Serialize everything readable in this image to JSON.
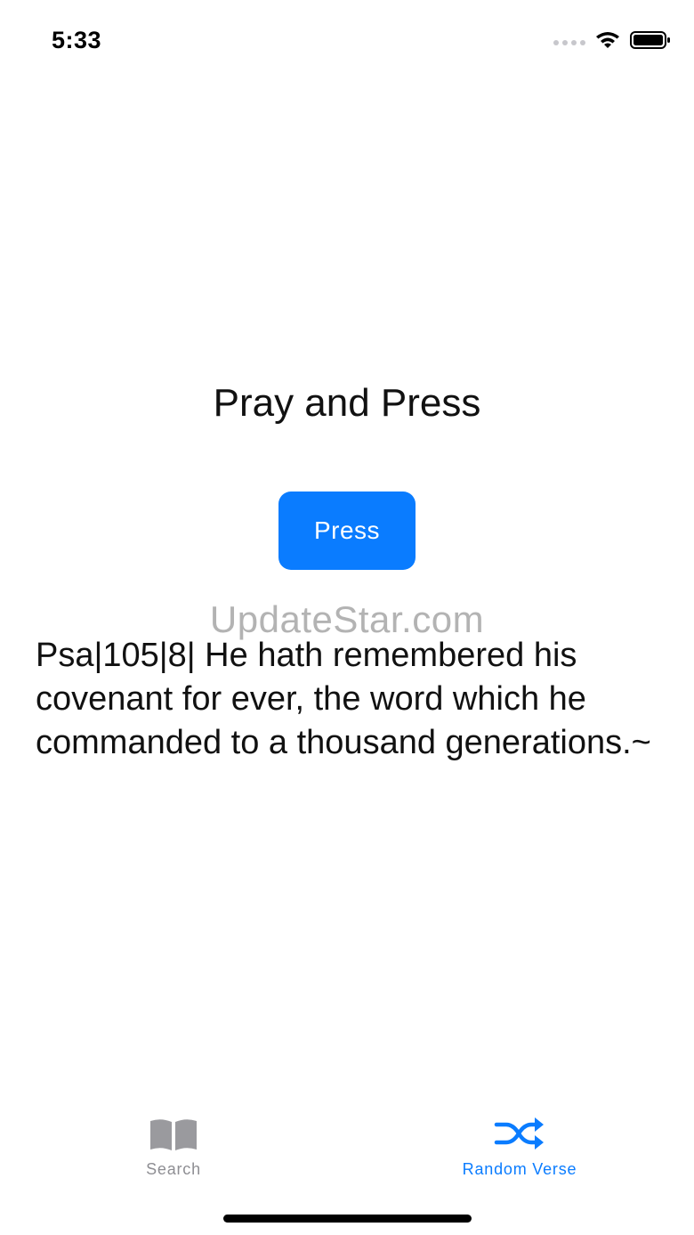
{
  "status_bar": {
    "time": "5:33",
    "icons": [
      "signal-dots-icon",
      "wifi-icon",
      "battery-icon"
    ]
  },
  "main": {
    "title": "Pray and Press",
    "press_button_label": "Press",
    "watermark": "UpdateStar.com",
    "verse": "Psa|105|8| He hath remembered his covenant for ever, the word which he commanded to a thousand generations.~"
  },
  "tab_bar": {
    "tabs": [
      {
        "label": "Search",
        "icon": "book-icon",
        "selected": false
      },
      {
        "label": "Random Verse",
        "icon": "shuffle-icon",
        "selected": true
      }
    ]
  },
  "colors": {
    "accent": "#0a7cff",
    "inactive_tab": "#8e8e93",
    "watermark": "#b3b3b3",
    "text": "#111111"
  }
}
